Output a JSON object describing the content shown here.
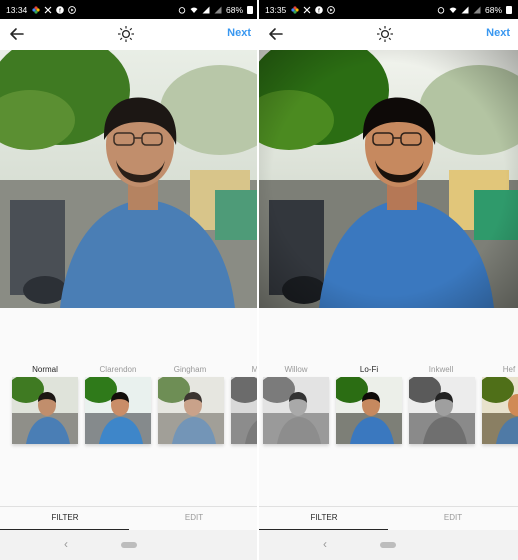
{
  "left": {
    "status": {
      "time": "13:34",
      "battery": "68%"
    },
    "toolbar": {
      "next_label": "Next"
    },
    "filters": [
      "Normal",
      "Clarendon",
      "Gingham",
      "M"
    ],
    "active_filter_index": 0,
    "tabs": {
      "filter": "FILTER",
      "edit": "EDIT"
    },
    "active_tab": "filter"
  },
  "right": {
    "status": {
      "time": "13:35",
      "battery": "68%"
    },
    "toolbar": {
      "next_label": "Next"
    },
    "filters": [
      "Willow",
      "Lo-Fi",
      "Inkwell",
      "Hef"
    ],
    "active_filter_index": 1,
    "tabs": {
      "filter": "FILTER",
      "edit": "EDIT"
    },
    "active_tab": "filter"
  },
  "icons": {
    "back": "arrow-left-icon",
    "lux": "sun-brightness-icon",
    "nav_back": "chevron-left-icon",
    "nav_home": "home-pill-icon"
  },
  "colors": {
    "accent": "#3897f0",
    "active_text": "#262626",
    "inactive_text": "#999999"
  }
}
